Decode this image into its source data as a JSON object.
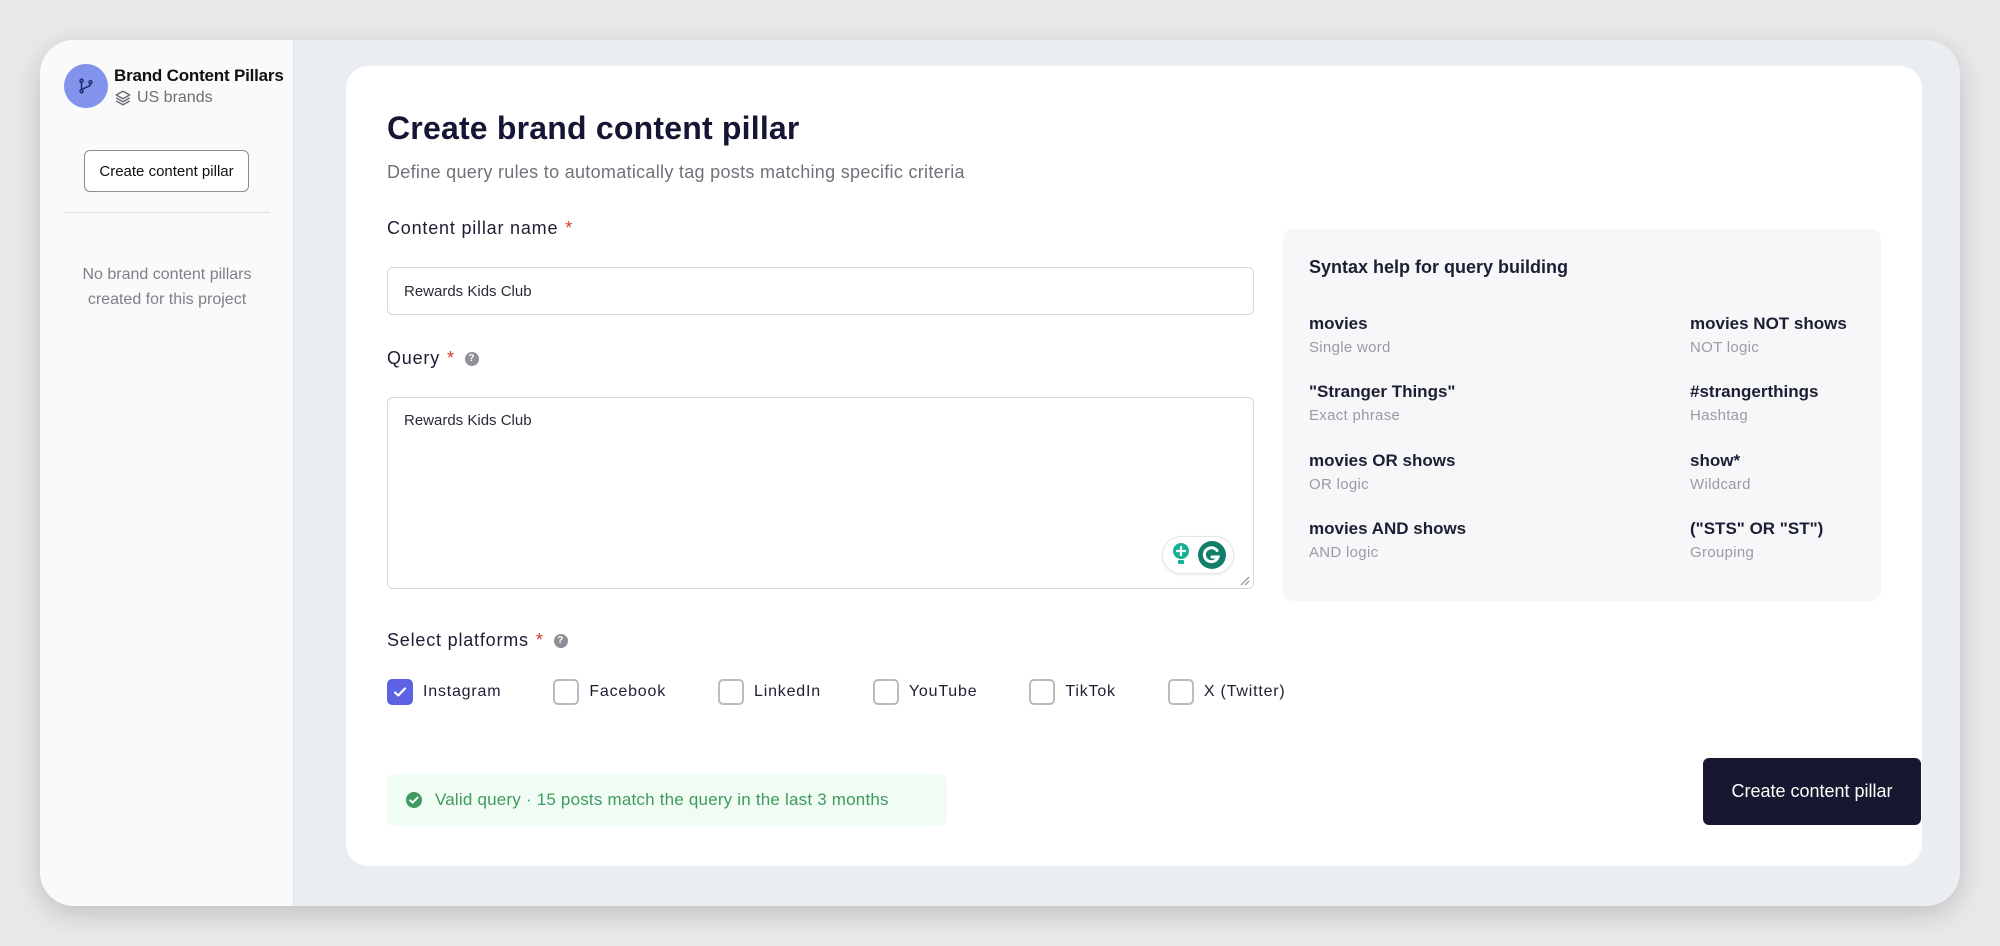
{
  "sidebar": {
    "project_title": "Brand Content Pillars",
    "project_subtitle": "US brands",
    "create_button": "Create content pillar",
    "empty_message": "No brand content pillars created for this project",
    "avatar_icon": "git-branch-icon",
    "subtitle_icon": "layers-icon"
  },
  "form": {
    "title": "Create brand content pillar",
    "subtitle": "Define query rules to automatically tag posts matching specific criteria",
    "name_label": "Content pillar name",
    "name_value": "Rewards Kids Club",
    "query_label": "Query",
    "query_value": "Rewards Kids Club",
    "platforms_label": "Select platforms",
    "required_marker": "*",
    "help_glyph": "?",
    "platforms": [
      {
        "label": "Instagram",
        "checked": true
      },
      {
        "label": "Facebook",
        "checked": false
      },
      {
        "label": "LinkedIn",
        "checked": false
      },
      {
        "label": "YouTube",
        "checked": false
      },
      {
        "label": "TikTok",
        "checked": false
      },
      {
        "label": "X (Twitter)",
        "checked": false
      }
    ],
    "status_text": "Valid query · 15 posts match the query in the last 3 months",
    "submit_button": "Create content pillar"
  },
  "syntax_help": {
    "title": "Syntax help for query building",
    "items": [
      {
        "code": "movies",
        "desc": "Single word"
      },
      {
        "code": "movies NOT shows",
        "desc": "NOT logic"
      },
      {
        "code": "\"Stranger Things\"",
        "desc": "Exact phrase"
      },
      {
        "code": "#strangerthings",
        "desc": "Hashtag"
      },
      {
        "code": "movies OR shows",
        "desc": "OR logic"
      },
      {
        "code": "show*",
        "desc": "Wildcard"
      },
      {
        "code": "movies AND shows",
        "desc": "AND logic"
      },
      {
        "code": "(\"STS\" OR \"ST\")",
        "desc": "Grouping"
      }
    ]
  },
  "colors": {
    "accent": "#5d62e3",
    "primary_button": "#17172f",
    "success": "#3f9a5f",
    "required": "#e0342e",
    "avatar": "#8193ea"
  }
}
